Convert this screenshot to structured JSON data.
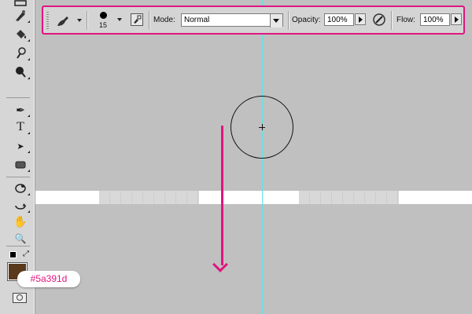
{
  "options_bar": {
    "brush_size": "15",
    "mode_label": "Mode:",
    "mode_value": "Normal",
    "opacity_label": "Opacity:",
    "opacity_value": "100%",
    "flow_label": "Flow:",
    "flow_value": "100%"
  },
  "tools": [
    {
      "icon": "marquee-icon"
    },
    {
      "icon": "healing-brush-icon"
    },
    {
      "icon": "paint-bucket-icon"
    },
    {
      "icon": "history-brush-icon"
    },
    {
      "icon": "dodge-icon"
    },
    {
      "icon": "pen-icon",
      "glyph": "✒"
    },
    {
      "icon": "type-icon",
      "glyph": "T"
    },
    {
      "icon": "path-selection-icon",
      "glyph": "➤"
    },
    {
      "icon": "rectangle-shape-icon"
    },
    {
      "icon": "3d-rotate-icon"
    },
    {
      "icon": "3d-orbit-icon"
    },
    {
      "icon": "hand-icon",
      "glyph": "✋"
    },
    {
      "icon": "zoom-icon",
      "glyph": "🔍"
    }
  ],
  "foreground_color": {
    "hex": "#5a391d",
    "label": "#5a391d"
  },
  "colors": {
    "highlight": "#e0157f",
    "guide": "#5fe3e6",
    "canvas": "#c0c0c0"
  }
}
